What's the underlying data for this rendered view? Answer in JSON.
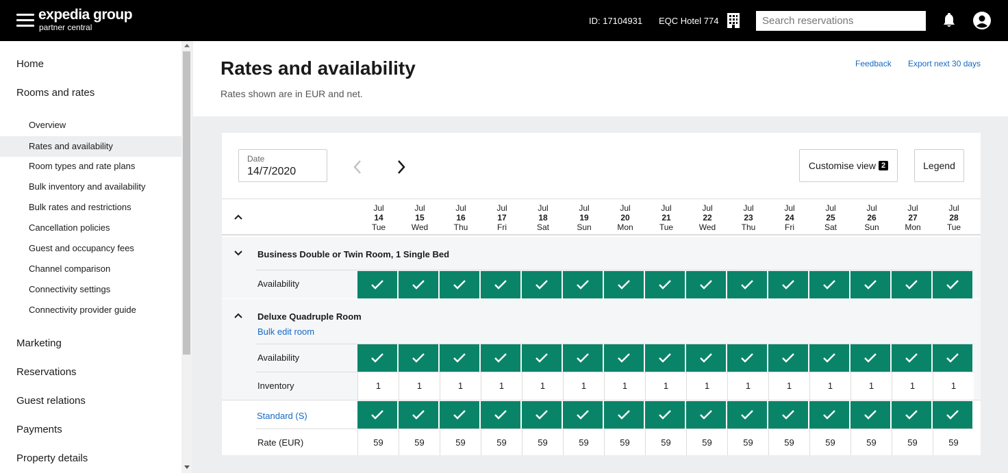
{
  "header": {
    "logo_main": "expedia group",
    "logo_sub": "partner central",
    "id_text": "ID: 17104931",
    "hotel_name": "EQC Hotel 774",
    "search_placeholder": "Search reservations"
  },
  "sidebar": {
    "top_items": [
      "Home",
      "Rooms and rates"
    ],
    "sub_items": [
      "Overview",
      "Rates and availability",
      "Room types and rate plans",
      "Bulk inventory and availability",
      "Bulk rates and restrictions",
      "Cancellation policies",
      "Guest and occupancy fees",
      "Channel comparison",
      "Connectivity settings",
      "Connectivity provider guide"
    ],
    "active_sub": "Rates and availability",
    "bottom_items": [
      "Marketing",
      "Reservations",
      "Guest relations",
      "Payments",
      "Property details"
    ]
  },
  "page": {
    "title": "Rates and availability",
    "subtitle": "Rates shown are in EUR and net.",
    "feedback_label": "Feedback",
    "export_label": "Export next 30 days"
  },
  "toolbar": {
    "date_label": "Date",
    "date_value": "14/7/2020",
    "customise_label": "Customise view",
    "customise_badge": "2",
    "legend_label": "Legend"
  },
  "days": [
    {
      "month": "Jul",
      "date": "14",
      "dow": "Tue"
    },
    {
      "month": "Jul",
      "date": "15",
      "dow": "Wed"
    },
    {
      "month": "Jul",
      "date": "16",
      "dow": "Thu"
    },
    {
      "month": "Jul",
      "date": "17",
      "dow": "Fri"
    },
    {
      "month": "Jul",
      "date": "18",
      "dow": "Sat"
    },
    {
      "month": "Jul",
      "date": "19",
      "dow": "Sun"
    },
    {
      "month": "Jul",
      "date": "20",
      "dow": "Mon"
    },
    {
      "month": "Jul",
      "date": "21",
      "dow": "Tue"
    },
    {
      "month": "Jul",
      "date": "22",
      "dow": "Wed"
    },
    {
      "month": "Jul",
      "date": "23",
      "dow": "Thu"
    },
    {
      "month": "Jul",
      "date": "24",
      "dow": "Fri"
    },
    {
      "month": "Jul",
      "date": "25",
      "dow": "Sat"
    },
    {
      "month": "Jul",
      "date": "26",
      "dow": "Sun"
    },
    {
      "month": "Jul",
      "date": "27",
      "dow": "Mon"
    },
    {
      "month": "Jul",
      "date": "28",
      "dow": "Tue"
    }
  ],
  "rooms": [
    {
      "name": "Business Double or Twin Room, 1 Single Bed",
      "availability_label": "Availability",
      "availability": [
        true,
        true,
        true,
        true,
        true,
        true,
        true,
        true,
        true,
        true,
        true,
        true,
        true,
        true,
        true
      ]
    },
    {
      "name": "Deluxe Quadruple Room",
      "bulk_edit_label": "Bulk edit room",
      "availability_label": "Availability",
      "availability": [
        true,
        true,
        true,
        true,
        true,
        true,
        true,
        true,
        true,
        true,
        true,
        true,
        true,
        true,
        true
      ],
      "inventory_label": "Inventory",
      "inventory": [
        "1",
        "1",
        "1",
        "1",
        "1",
        "1",
        "1",
        "1",
        "1",
        "1",
        "1",
        "1",
        "1",
        "1",
        "1"
      ],
      "rate_plan": {
        "name": "Standard (S)",
        "availability": [
          true,
          true,
          true,
          true,
          true,
          true,
          true,
          true,
          true,
          true,
          true,
          true,
          true,
          true,
          true
        ],
        "rate_label": "Rate (EUR)",
        "rates": [
          "59",
          "59",
          "59",
          "59",
          "59",
          "59",
          "59",
          "59",
          "59",
          "59",
          "59",
          "59",
          "59",
          "59",
          "59"
        ]
      }
    }
  ],
  "colors": {
    "available": "#0a8468",
    "link": "#1668c1",
    "topbar": "#000000"
  }
}
